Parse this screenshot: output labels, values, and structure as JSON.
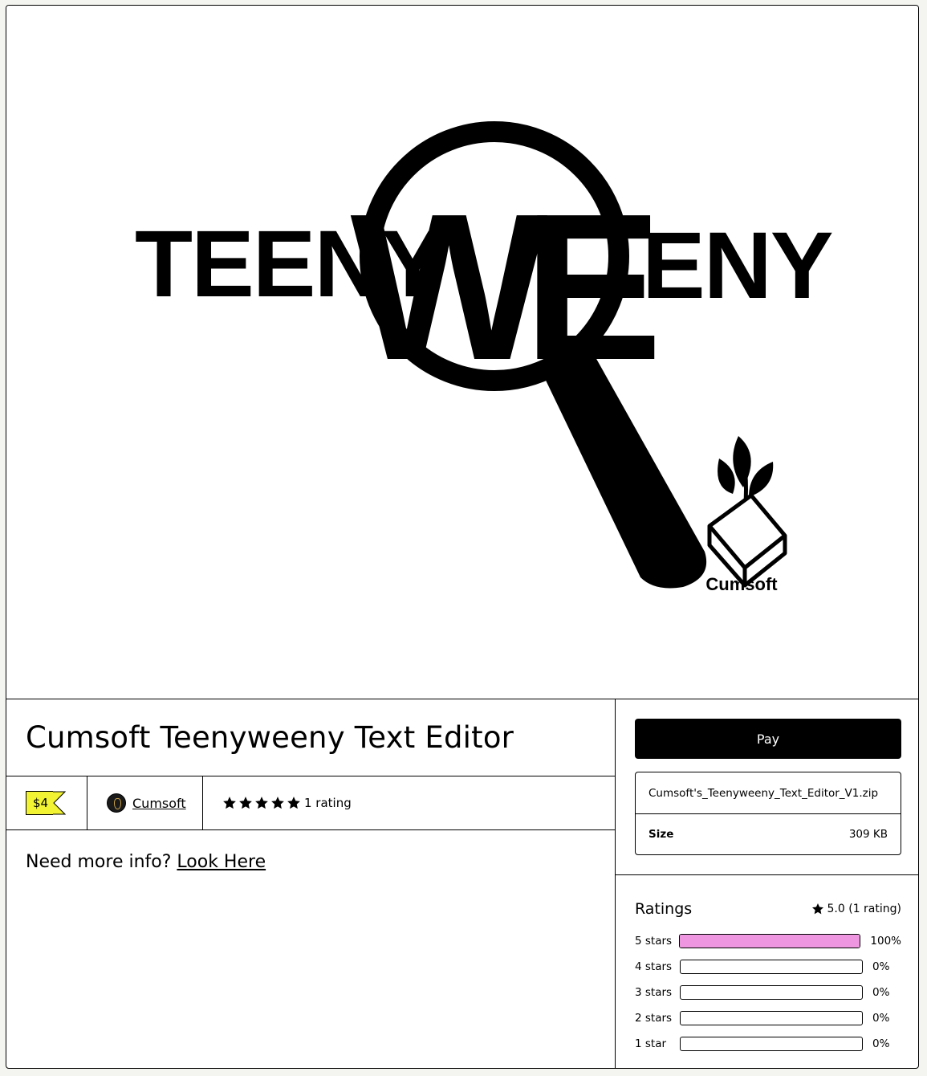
{
  "cover": {
    "logo_left": "TEENY",
    "logo_mark": "WE",
    "logo_right": "ENY",
    "brand": "Cumsoft"
  },
  "product": {
    "title": "Cumsoft Teenyweeny Text Editor",
    "price": "$4",
    "creator": "Cumsoft",
    "stars": 5,
    "rating_count": "1 rating",
    "description_prefix": "Need more info?",
    "description_link": "Look Here"
  },
  "purchase": {
    "pay_label": "Pay",
    "file_name": "Cumsoft's_Teenyweeny_Text_Editor_V1.zip",
    "size_label": "Size",
    "size_value": "309 KB"
  },
  "ratings": {
    "title": "Ratings",
    "summary": "5.0 (1 rating)",
    "rows": [
      {
        "label": "5 stars",
        "percent": "100%",
        "fraction": 1.0
      },
      {
        "label": "4 stars",
        "percent": "0%",
        "fraction": 0
      },
      {
        "label": "3 stars",
        "percent": "0%",
        "fraction": 0
      },
      {
        "label": "2 stars",
        "percent": "0%",
        "fraction": 0
      },
      {
        "label": "1 star",
        "percent": "0%",
        "fraction": 0
      }
    ]
  },
  "colors": {
    "price_tag": "#f1f333",
    "rating_bar": "#ee97e0",
    "pay_button": "#000000"
  }
}
